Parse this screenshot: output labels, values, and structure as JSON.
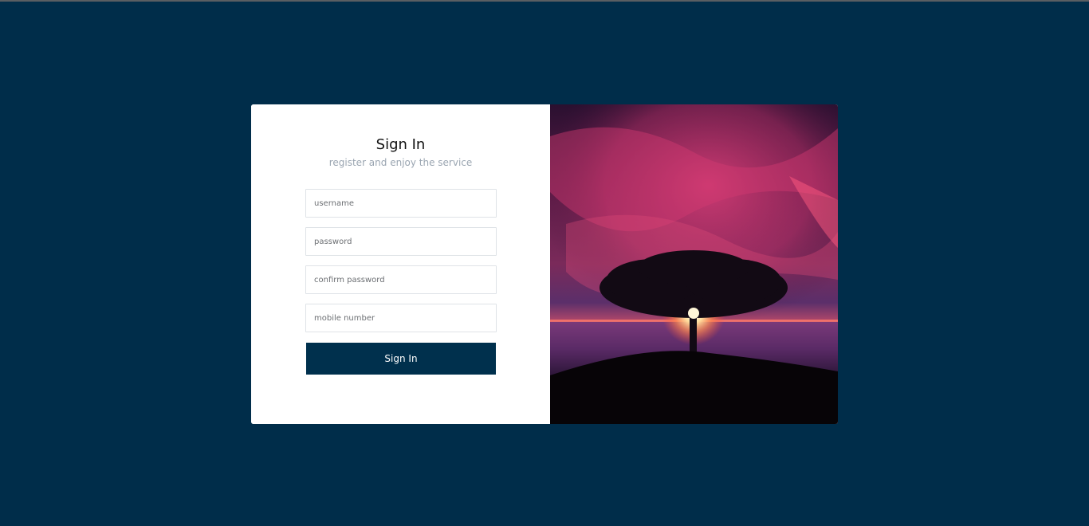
{
  "form": {
    "title": "Sign In",
    "subtitle": "register and enjoy the service",
    "fields": {
      "username_placeholder": "username",
      "password_placeholder": "password",
      "confirm_password_placeholder": "confirm password",
      "mobile_placeholder": "mobile number"
    },
    "submit_label": "Sign In"
  },
  "theme": {
    "page_background": "#002d4a",
    "button_color": "#00304d",
    "card_background": "#ffffff",
    "subtitle_color": "#9aa5b1"
  }
}
